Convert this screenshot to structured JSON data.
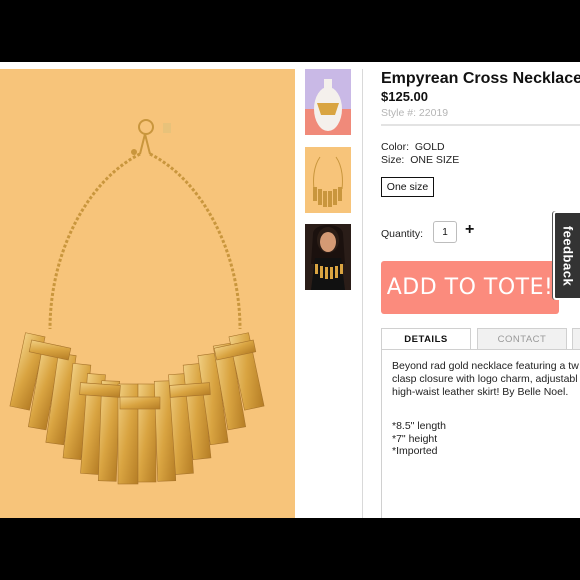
{
  "product": {
    "title": "Empyrean Cross Necklace",
    "price": "$125.00",
    "style": "Style #: 22019",
    "color_label": "Color:",
    "color_value": "GOLD",
    "size_label": "Size:",
    "size_value": "ONE SIZE",
    "size_option": "One size",
    "quantity_label": "Quantity:",
    "quantity_value": "1",
    "quantity_plus": "+",
    "add_button": "ADD TO TOTE!"
  },
  "tabs": [
    {
      "label": "DETAILS",
      "active": true
    },
    {
      "label": "CONTACT",
      "active": false
    }
  ],
  "details": {
    "description": [
      "Beyond rad gold necklace featuring a tw",
      "clasp closure with logo charm, adjustabl",
      "high-waist leather skirt!  By Belle Noel."
    ],
    "specs": [
      "*8.5\" length",
      "*7\" height",
      "*Imported"
    ]
  },
  "feedback": {
    "label": "feedback"
  },
  "colors": {
    "hero_bg": "#f7c47a",
    "gold": "#d9a441",
    "add_button": "#fb8b7d",
    "feedback_bg": "#333333"
  }
}
